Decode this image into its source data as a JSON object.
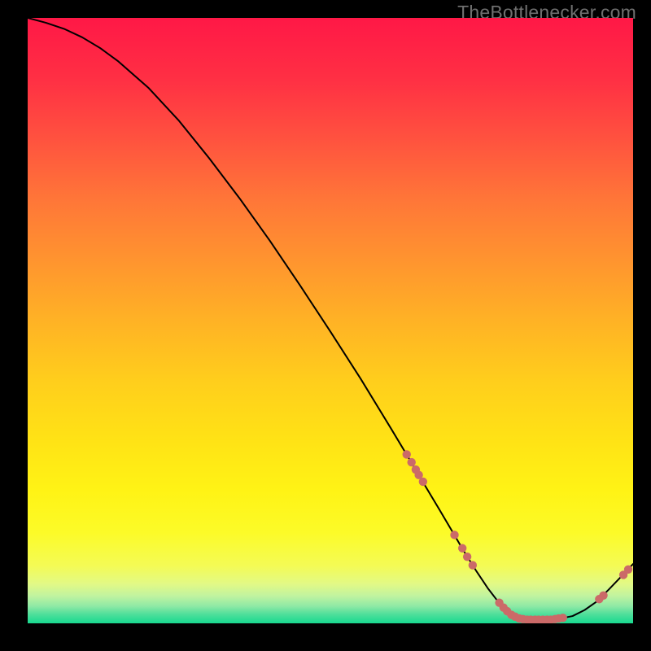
{
  "watermark": "TheBottleneсker.com",
  "chart_data": {
    "type": "line",
    "title": "",
    "xlabel": "",
    "ylabel": "",
    "xlim": [
      0,
      100
    ],
    "ylim": [
      0,
      100
    ],
    "background": "rainbow-vertical",
    "grid": false,
    "x": [
      0,
      3,
      6,
      9,
      12,
      15,
      20,
      25,
      30,
      35,
      40,
      45,
      50,
      55,
      60,
      63,
      65,
      68,
      70,
      72,
      74,
      76,
      78,
      80,
      82,
      84,
      86,
      88,
      90,
      92,
      94,
      96,
      98.5,
      100
    ],
    "y": [
      100,
      99.2,
      98.2,
      96.8,
      95.0,
      92.8,
      88.4,
      83.0,
      76.8,
      70.2,
      63.2,
      55.8,
      48.2,
      40.4,
      32.2,
      27.2,
      23.8,
      18.8,
      15.4,
      12.0,
      8.8,
      5.8,
      3.2,
      1.4,
      0.6,
      0.6,
      0.6,
      0.8,
      1.2,
      2.2,
      3.6,
      5.6,
      8.2,
      9.8
    ],
    "markers": [
      {
        "x": 62.6,
        "y": 27.9
      },
      {
        "x": 63.4,
        "y": 26.6
      },
      {
        "x": 64.1,
        "y": 25.4
      },
      {
        "x": 64.6,
        "y": 24.5
      },
      {
        "x": 65.3,
        "y": 23.4
      },
      {
        "x": 70.5,
        "y": 14.6
      },
      {
        "x": 71.8,
        "y": 12.4
      },
      {
        "x": 72.6,
        "y": 11.0
      },
      {
        "x": 73.5,
        "y": 9.6
      },
      {
        "x": 77.9,
        "y": 3.4
      },
      {
        "x": 78.6,
        "y": 2.6
      },
      {
        "x": 79.2,
        "y": 2.0
      },
      {
        "x": 79.9,
        "y": 1.4
      },
      {
        "x": 80.5,
        "y": 1.1
      },
      {
        "x": 81.2,
        "y": 0.8
      },
      {
        "x": 81.8,
        "y": 0.7
      },
      {
        "x": 82.5,
        "y": 0.6
      },
      {
        "x": 83.1,
        "y": 0.6
      },
      {
        "x": 83.8,
        "y": 0.6
      },
      {
        "x": 84.4,
        "y": 0.6
      },
      {
        "x": 85.1,
        "y": 0.6
      },
      {
        "x": 85.8,
        "y": 0.6
      },
      {
        "x": 86.4,
        "y": 0.6
      },
      {
        "x": 87.1,
        "y": 0.7
      },
      {
        "x": 87.7,
        "y": 0.8
      },
      {
        "x": 88.4,
        "y": 0.9
      },
      {
        "x": 94.4,
        "y": 4.0
      },
      {
        "x": 95.1,
        "y": 4.6
      },
      {
        "x": 98.4,
        "y": 8.0
      },
      {
        "x": 99.2,
        "y": 8.9
      }
    ],
    "marker_color": "#cb6a68",
    "line_color": "#000000"
  }
}
